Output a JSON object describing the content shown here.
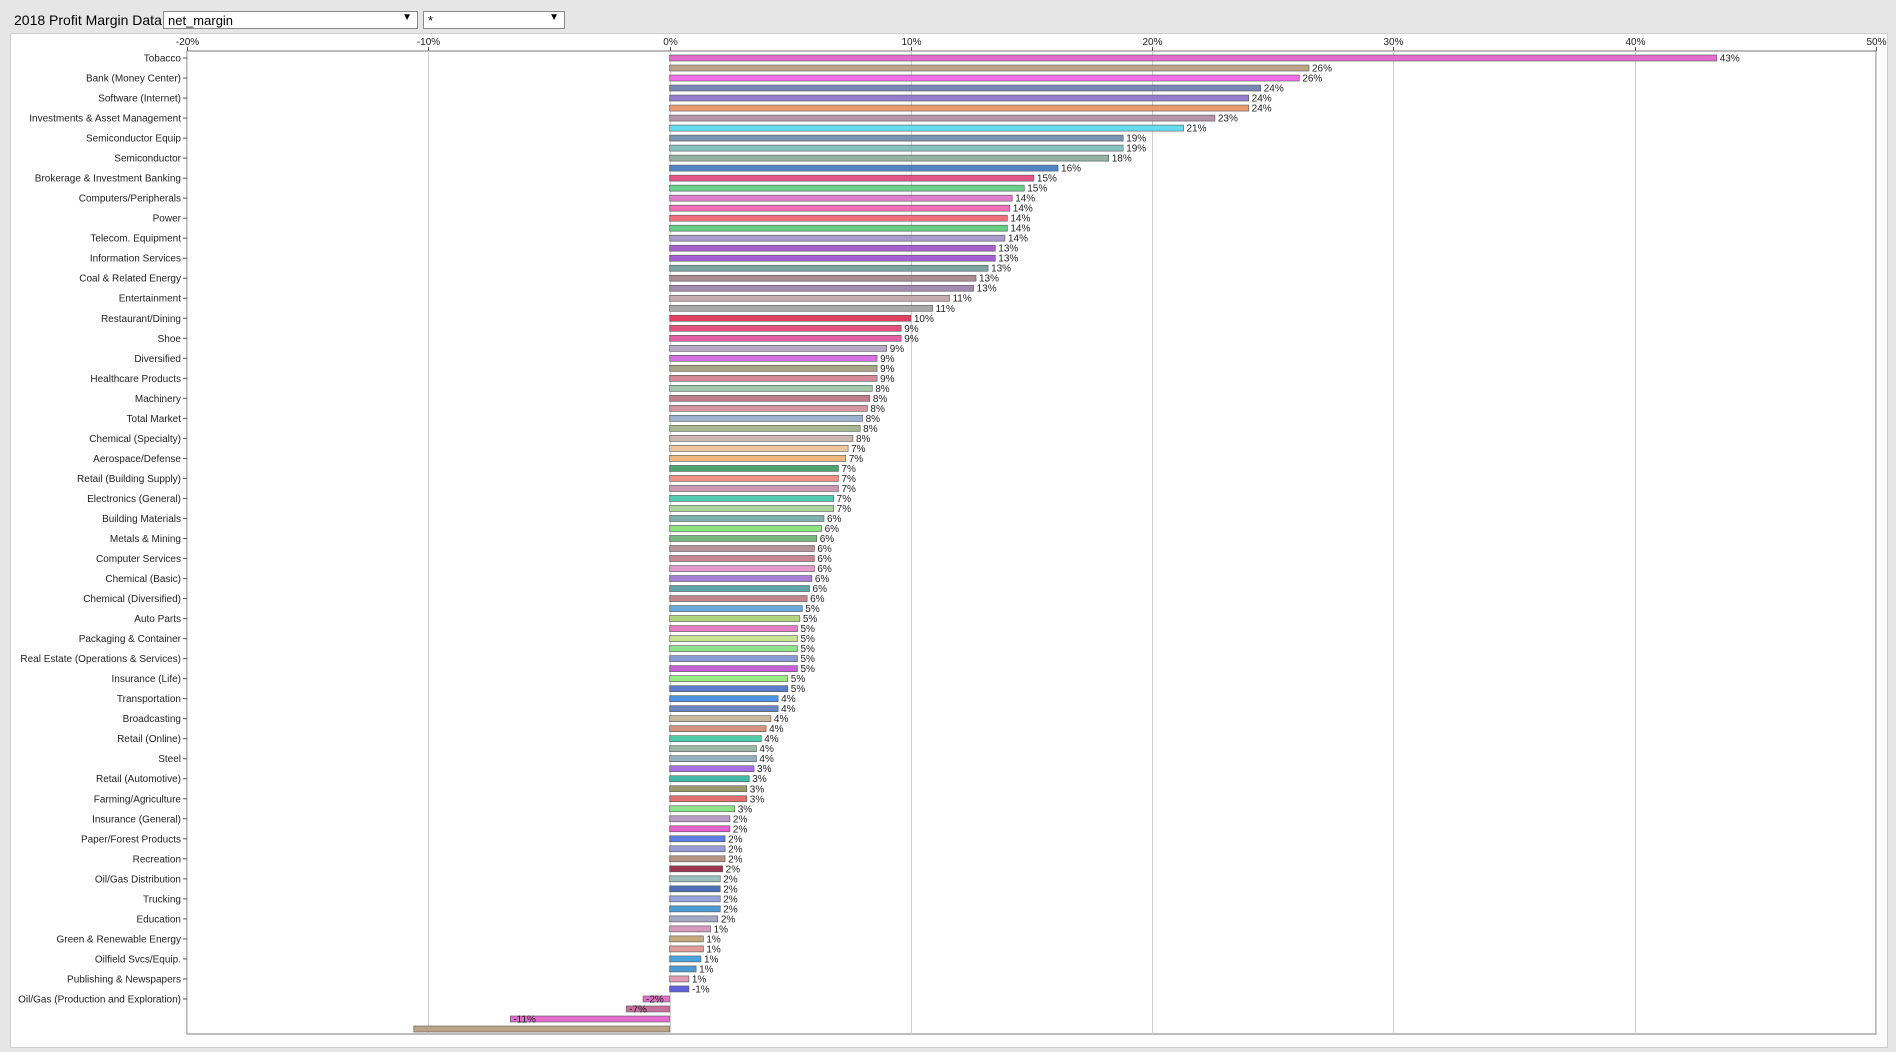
{
  "header": {
    "title": "2018 Profit Margin Data",
    "metric_select": "net_margin",
    "filter_select": "*"
  },
  "chart_data": {
    "type": "bar",
    "orientation": "horizontal",
    "title": "",
    "xlabel": "",
    "ylabel": "",
    "xlim": [
      -20,
      50
    ],
    "x_ticks": [
      "-20%",
      "-10%",
      "0%",
      "10%",
      "20%",
      "30%",
      "40%",
      "50%"
    ],
    "grid": true,
    "value_labels": [
      "43%",
      "26%",
      "26%",
      "24%",
      "24%",
      "24%",
      "23%",
      "21%",
      "19%",
      "19%",
      "18%",
      "16%",
      "15%",
      "15%",
      "14%",
      "14%",
      "14%",
      "14%",
      "14%",
      "13%",
      "13%",
      "13%",
      "13%",
      "13%",
      "11%",
      "11%",
      "10%",
      "9%",
      "9%",
      "9%",
      "9%",
      "9%",
      "9%",
      "8%",
      "8%",
      "8%",
      "8%",
      "8%",
      "8%",
      "7%",
      "7%",
      "7%",
      "7%",
      "7%",
      "7%",
      "7%",
      "6%",
      "6%",
      "6%",
      "6%",
      "6%",
      "6%",
      "6%",
      "6%",
      "6%",
      "5%",
      "5%",
      "5%",
      "5%",
      "5%",
      "5%",
      "5%",
      "5%",
      "5%",
      "4%",
      "4%",
      "4%",
      "4%",
      "4%",
      "4%",
      "4%",
      "3%",
      "3%",
      "3%",
      "3%",
      "3%",
      "2%",
      "2%",
      "2%",
      "2%",
      "2%",
      "2%",
      "2%",
      "2%",
      "2%",
      "2%",
      "2%",
      "1%",
      "1%",
      "1%",
      "1%",
      "1%",
      "1%",
      "-1%",
      "-2%",
      "-7%",
      "-11%"
    ],
    "values": [
      43.4,
      26.5,
      26.1,
      24.5,
      24.0,
      24.0,
      22.6,
      21.3,
      18.8,
      18.8,
      18.2,
      16.1,
      15.1,
      14.7,
      14.2,
      14.1,
      14.0,
      14.0,
      13.9,
      13.5,
      13.5,
      13.2,
      12.7,
      12.6,
      11.6,
      10.9,
      10.0,
      9.6,
      9.6,
      9.0,
      8.6,
      8.6,
      8.6,
      8.4,
      8.3,
      8.2,
      8.0,
      7.9,
      7.6,
      7.4,
      7.3,
      7.0,
      7.0,
      7.0,
      6.8,
      6.8,
      6.4,
      6.3,
      6.1,
      6.0,
      6.0,
      6.0,
      5.9,
      5.8,
      5.7,
      5.5,
      5.4,
      5.3,
      5.3,
      5.3,
      5.3,
      5.3,
      4.9,
      4.9,
      4.5,
      4.5,
      4.2,
      4.0,
      3.8,
      3.6,
      3.6,
      3.5,
      3.3,
      3.2,
      3.2,
      2.7,
      2.5,
      2.5,
      2.3,
      2.3,
      2.3,
      2.2,
      2.1,
      2.1,
      2.1,
      2.1,
      2.0,
      1.7,
      1.4,
      1.4,
      1.3,
      1.1,
      0.8,
      0.8,
      -1.1,
      -1.8,
      -6.6,
      -10.6
    ],
    "category_labels": [
      {
        "index": 0,
        "label": "Tobacco"
      },
      {
        "index": 2,
        "label": "Bank (Money Center)"
      },
      {
        "index": 4,
        "label": "Software (Internet)"
      },
      {
        "index": 6,
        "label": "Investments & Asset Management"
      },
      {
        "index": 8,
        "label": "Semiconductor Equip"
      },
      {
        "index": 10,
        "label": "Semiconductor"
      },
      {
        "index": 12,
        "label": "Brokerage & Investment Banking"
      },
      {
        "index": 14,
        "label": "Computers/Peripherals"
      },
      {
        "index": 16,
        "label": "Power"
      },
      {
        "index": 18,
        "label": "Telecom. Equipment"
      },
      {
        "index": 20,
        "label": "Information Services"
      },
      {
        "index": 22,
        "label": "Coal & Related Energy"
      },
      {
        "index": 24,
        "label": "Entertainment"
      },
      {
        "index": 26,
        "label": "Restaurant/Dining"
      },
      {
        "index": 28,
        "label": "Shoe"
      },
      {
        "index": 30,
        "label": "Diversified"
      },
      {
        "index": 32,
        "label": "Healthcare Products"
      },
      {
        "index": 34,
        "label": "Machinery"
      },
      {
        "index": 36,
        "label": "Total Market"
      },
      {
        "index": 38,
        "label": "Chemical (Specialty)"
      },
      {
        "index": 40,
        "label": "Aerospace/Defense"
      },
      {
        "index": 42,
        "label": "Retail (Building Supply)"
      },
      {
        "index": 44,
        "label": "Electronics (General)"
      },
      {
        "index": 46,
        "label": "Building Materials"
      },
      {
        "index": 48,
        "label": "Metals & Mining"
      },
      {
        "index": 50,
        "label": "Computer Services"
      },
      {
        "index": 52,
        "label": "Chemical (Basic)"
      },
      {
        "index": 54,
        "label": "Chemical (Diversified)"
      },
      {
        "index": 56,
        "label": "Auto Parts"
      },
      {
        "index": 58,
        "label": "Packaging & Container"
      },
      {
        "index": 60,
        "label": "Real Estate (Operations & Services)"
      },
      {
        "index": 62,
        "label": "Insurance (Life)"
      },
      {
        "index": 64,
        "label": "Transportation"
      },
      {
        "index": 66,
        "label": "Broadcasting"
      },
      {
        "index": 68,
        "label": "Retail (Online)"
      },
      {
        "index": 70,
        "label": "Steel"
      },
      {
        "index": 72,
        "label": "Retail (Automotive)"
      },
      {
        "index": 74,
        "label": "Farming/Agriculture"
      },
      {
        "index": 76,
        "label": "Insurance (General)"
      },
      {
        "index": 78,
        "label": "Paper/Forest Products"
      },
      {
        "index": 80,
        "label": "Recreation"
      },
      {
        "index": 82,
        "label": "Oil/Gas Distribution"
      },
      {
        "index": 84,
        "label": "Trucking"
      },
      {
        "index": 86,
        "label": "Education"
      },
      {
        "index": 88,
        "label": "Green & Renewable Energy"
      },
      {
        "index": 90,
        "label": "Oilfield Svcs/Equip."
      },
      {
        "index": 92,
        "label": "Publishing & Newspapers"
      },
      {
        "index": 94,
        "label": "Oil/Gas (Production and Exploration)"
      }
    ],
    "colors": [
      "#e05cc6",
      "#b59a7a",
      "#f060e8",
      "#6a7ab0",
      "#8b6fc8",
      "#e89060",
      "#b08aa0",
      "#55d8f0",
      "#6a88a8",
      "#7abbb8",
      "#8aaa9a",
      "#3a78c0",
      "#e0407a",
      "#58cc80",
      "#e070c8",
      "#f060b0",
      "#f06070",
      "#58c878",
      "#a090c8",
      "#a050c8",
      "#9a50d0",
      "#6a9a98",
      "#a08088",
      "#9a80a8",
      "#c0a0a8",
      "#a0a0a0",
      "#e02a50",
      "#e04070",
      "#e0509a",
      "#b0a0c0",
      "#d060e0",
      "#a09a78",
      "#d07a90",
      "#9ac0a0",
      "#b87080",
      "#d08a98",
      "#90a8c8",
      "#a0b088",
      "#c8b0a8",
      "#e8c090",
      "#f0b070",
      "#3a9a60",
      "#f08878",
      "#c890a8",
      "#40c8a8",
      "#a0d090",
      "#70a8a0",
      "#80e070",
      "#68b070",
      "#b08890",
      "#c07a88",
      "#e090c8",
      "#a070d0",
      "#509aa0",
      "#b87a80",
      "#5aa0d8",
      "#a8d070",
      "#e070c0",
      "#c0e088",
      "#80e080",
      "#7a90d0",
      "#c050d0",
      "#90e878",
      "#4a70c8",
      "#3a88e0",
      "#5a7ab8",
      "#c0b090",
      "#d08870",
      "#40c8a0",
      "#90b0a0",
      "#88a8b8",
      "#a060e0",
      "#30b0a0",
      "#909060",
      "#e06060",
      "#80e080",
      "#b090c0",
      "#e050c8",
      "#4a70e0",
      "#9090d0",
      "#b08878",
      "#902040",
      "#90b8b8",
      "#3a60b0",
      "#8a9ad8",
      "#3a90d0",
      "#9aa0c0",
      "#d090b8",
      "#c0a070",
      "#e09090",
      "#3a9ad8",
      "#3a90d0",
      "#e090b0",
      "#5050d8",
      "#e060c0",
      "#c06090"
    ]
  }
}
